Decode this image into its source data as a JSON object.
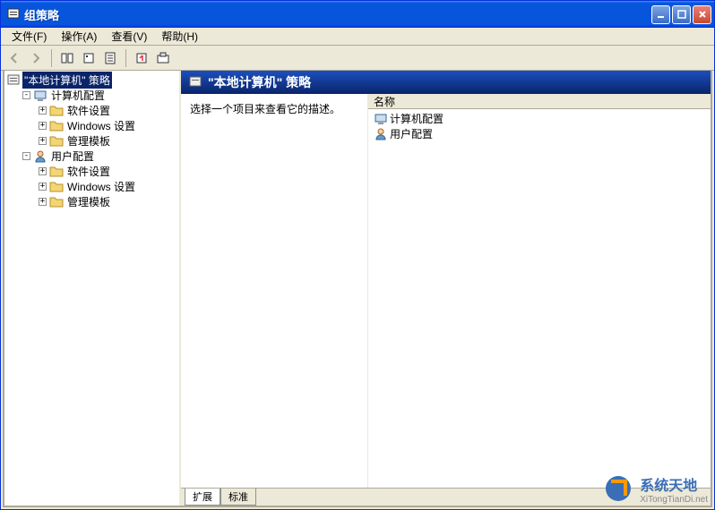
{
  "window": {
    "title": "组策略"
  },
  "menu": {
    "file": "文件(F)",
    "action": "操作(A)",
    "view": "查看(V)",
    "help": "帮助(H)"
  },
  "tree": {
    "root": "\"本地计算机\" 策略",
    "computer_config": "计算机配置",
    "user_config": "用户配置",
    "software_settings": "软件设置",
    "windows_settings": "Windows 设置",
    "admin_templates": "管理模板"
  },
  "right": {
    "header": "\"本地计算机\" 策略",
    "description": "选择一个项目来查看它的描述。",
    "col_name": "名称",
    "items": {
      "computer": "计算机配置",
      "user": "用户配置"
    }
  },
  "tabs": {
    "extended": "扩展",
    "standard": "标准"
  },
  "watermark": {
    "main": "系统天地",
    "sub": "XiTongTianDi.net"
  }
}
